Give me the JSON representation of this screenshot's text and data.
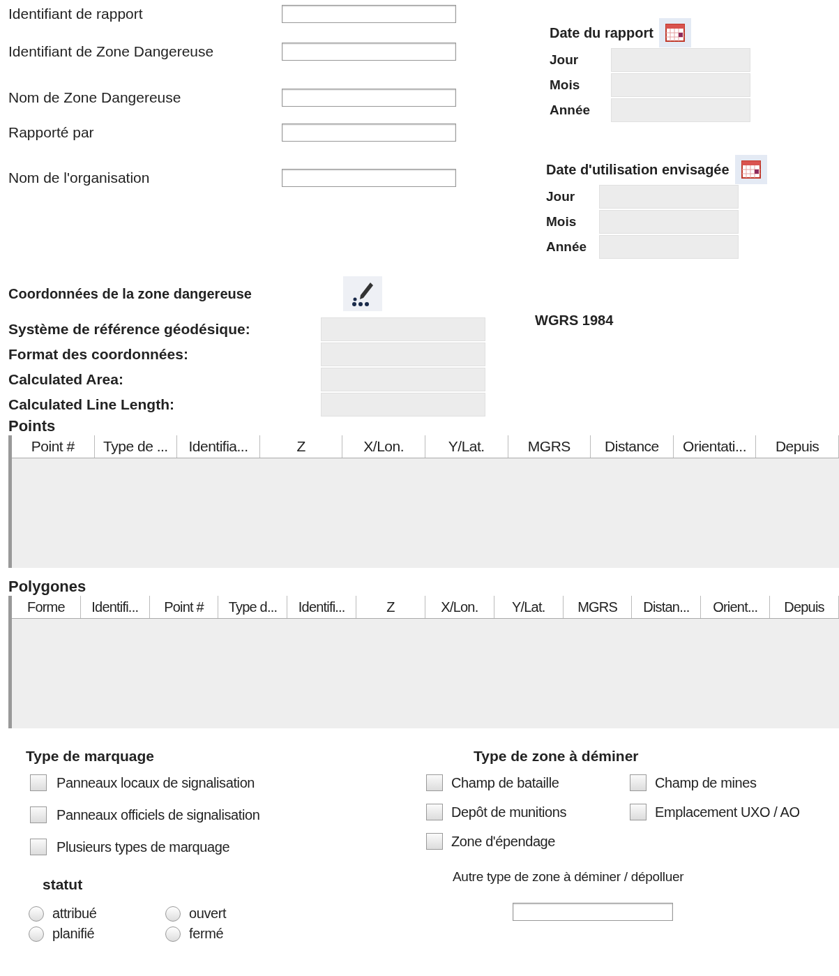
{
  "fields": [
    {
      "label": "Identifiant de rapport"
    },
    {
      "label": "Identifiant de Zone Dangereuse"
    },
    {
      "label": "Nom de Zone Dangereuse"
    },
    {
      "label": "Rapporté par"
    },
    {
      "label": "Nom de l'organisation"
    }
  ],
  "report_date": {
    "title": "Date du rapport",
    "parts": [
      {
        "label": "Jour"
      },
      {
        "label": "Mois"
      },
      {
        "label": "Année"
      }
    ]
  },
  "planned_date": {
    "title": "Date d'utilisation envisagée",
    "parts": [
      {
        "label": "Jour"
      },
      {
        "label": "Mois"
      },
      {
        "label": "Année"
      }
    ]
  },
  "coordinates": {
    "title": "Coordonnées de la zone dangereuse",
    "reference": "WGRS 1984",
    "rows": [
      {
        "label": "Système de référence géodésique:"
      },
      {
        "label": "Format des coordonnées:"
      },
      {
        "label": "Calculated Area:"
      },
      {
        "label": "Calculated Line Length:"
      }
    ]
  },
  "points": {
    "title": "Points",
    "columns": [
      "Point #",
      "Type de ...",
      "Identifia...",
      "Z",
      "X/Lon.",
      "Y/Lat.",
      "MGRS",
      "Distance",
      "Orientati...",
      "Depuis"
    ]
  },
  "polygons": {
    "title": "Polygones",
    "columns": [
      "Forme",
      "Identifi...",
      "Point #",
      "Type d...",
      "Identifi...",
      "Z",
      "X/Lon.",
      "Y/Lat.",
      "MGRS",
      "Distan...",
      "Orient...",
      "Depuis"
    ]
  },
  "marking": {
    "title": "Type de marquage",
    "options": [
      {
        "label": "Panneaux locaux de signalisation",
        "checked": false
      },
      {
        "label": "Panneaux officiels de signalisation",
        "checked": false
      },
      {
        "label": "Plusieurs types de marquage",
        "checked": false
      }
    ]
  },
  "status": {
    "title": "statut",
    "options": [
      {
        "label": "attribué",
        "selected": false
      },
      {
        "label": "ouvert",
        "selected": false
      },
      {
        "label": "planifié",
        "selected": false
      },
      {
        "label": "fermé",
        "selected": false
      }
    ]
  },
  "zone_type": {
    "title": "Type de zone à déminer",
    "options": [
      {
        "label": "Champ de bataille",
        "checked": false
      },
      {
        "label": "Champ de mines",
        "checked": false
      },
      {
        "label": "Depôt de munitions",
        "checked": false
      },
      {
        "label": "Emplacement UXO / AO",
        "checked": false
      },
      {
        "label": "Zone d'épendage",
        "checked": false
      }
    ],
    "other_label": "Autre type de zone à déminer / dépolluer"
  }
}
